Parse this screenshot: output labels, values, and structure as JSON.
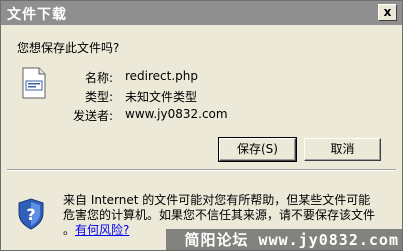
{
  "window": {
    "title": "文件下载",
    "close_glyph": "x"
  },
  "dialog": {
    "question": "您想保存此文件吗?",
    "fields": [
      {
        "label": "名称:",
        "value": "redirect.php"
      },
      {
        "label": "类型:",
        "value": "未知文件类型"
      },
      {
        "label": "发送者:",
        "value": "www.jy0832.com"
      }
    ],
    "buttons": {
      "save": "保存(S)",
      "cancel": "取消"
    },
    "warning_line1": "来自 Internet 的文件可能对您有所帮助，但某些文件可能",
    "warning_line2": "危害您的计算机。如果您不信任其来源，请不要保存该文件",
    "warning_link": "有何风险?",
    "warning_prefix": "。"
  },
  "watermark": "简阳论坛 www.jy0832.com",
  "colors": {
    "titlebar": "#8f8f8f",
    "face": "#ece9d8",
    "link": "#0000ee"
  }
}
